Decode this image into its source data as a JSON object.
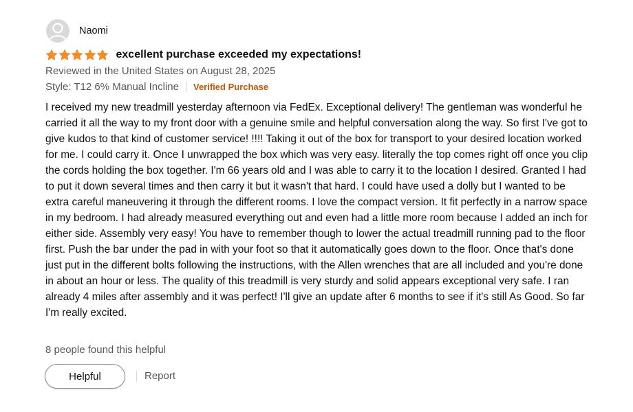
{
  "review": {
    "author": {
      "name": "Naomi",
      "avatar_icon": "user-silhouette-icon"
    },
    "rating": 5,
    "rating_max": 5,
    "star_color": "#ff8c1a",
    "title": "excellent purchase exceeded my expectations!",
    "date_text": "Reviewed in the United States on August 28, 2025",
    "style_text": "Style: T12 6% Manual Incline",
    "verified_label": "Verified Purchase",
    "verified_color": "#c45500",
    "body": "I received my new treadmill yesterday afternoon via FedEx. Exceptional delivery! The gentleman was wonderful he carried it all the way to my front door with a genuine smile and helpful conversation along the way. So first I've got to give kudos to that kind of customer service! !!!! Taking it out of the box for transport to your desired location worked for me. I could carry it. Once I unwrapped the box which was very easy. literally the top comes right off once you clip the cords holding the box together. I'm 66 years old and I was able to carry it to the location I desired. Granted I had to put it down several times and then carry it but it wasn't that hard. I could have used a dolly but I wanted to be extra careful maneuvering it through the different rooms. I love the compact version. It fit perfectly in a narrow space in my bedroom. I had already measured everything out and even had a little more room because I added an inch for either side. Assembly very easy! You have to remember though to lower the actual treadmill running pad to the floor first. Push the bar under the pad in with your foot so that it automatically goes down to the floor. Once that's done just put in the different bolts following the instructions, with the Allen wrenches that are all included and you're done in about an hour or less. The quality of this treadmill is very sturdy and solid appears exceptional very safe. I ran already 4 miles after assembly and it was perfect! I'll give an update after 6 months to see if it's still As Good. So far I'm really excited.",
    "helpful_count_text": "8 people found this helpful",
    "helpful_button_label": "Helpful",
    "report_label": "Report"
  }
}
